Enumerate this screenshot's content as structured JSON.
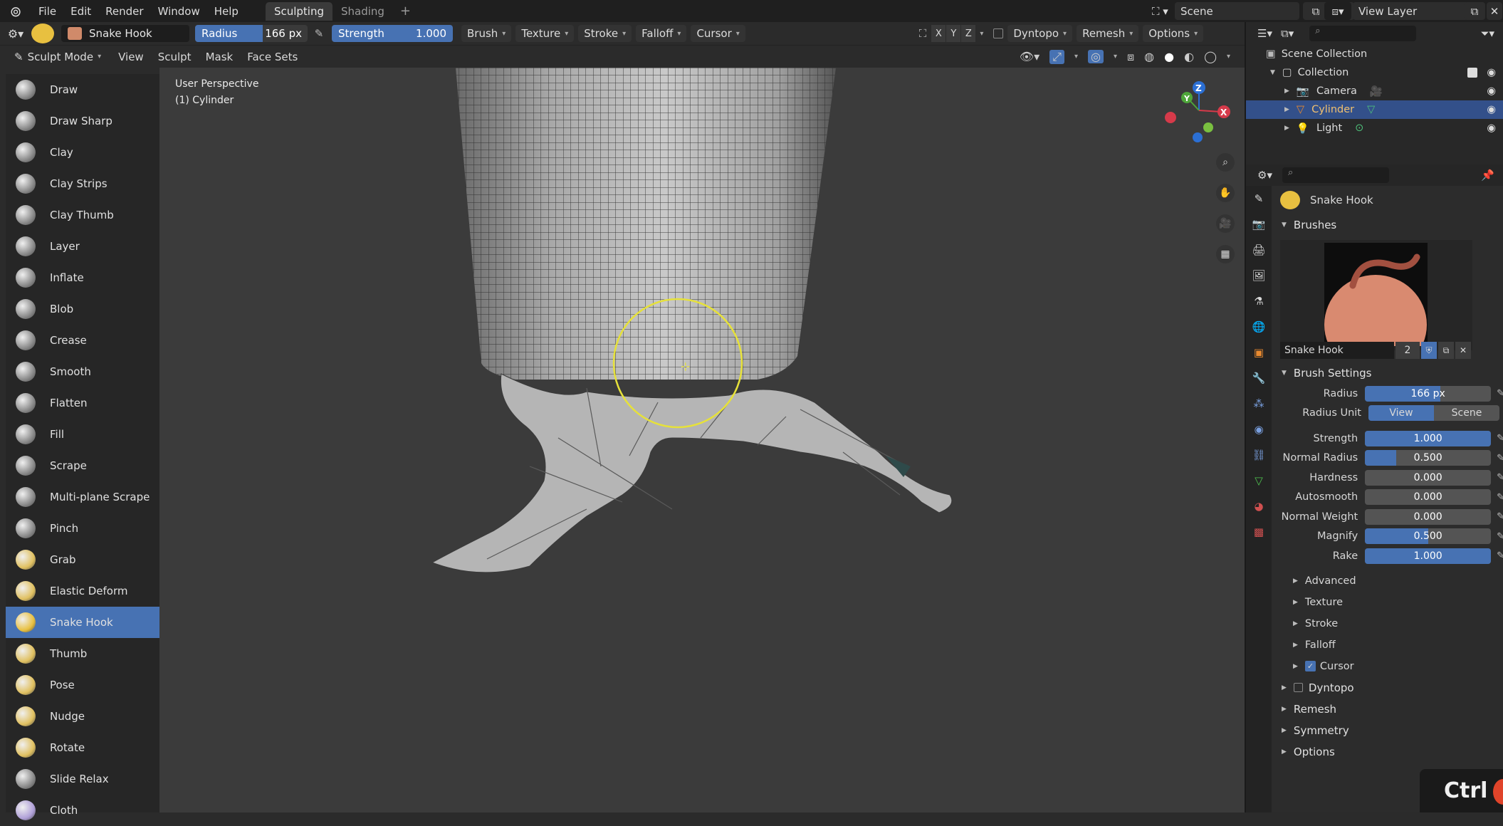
{
  "menu": [
    "File",
    "Edit",
    "Render",
    "Window",
    "Help"
  ],
  "workspaces": [
    {
      "label": "Sculpting",
      "active": true
    },
    {
      "label": "Shading",
      "active": false
    }
  ],
  "scene": "Scene",
  "view_layer": "View Layer",
  "header": {
    "brush_name": "Snake Hook",
    "radius_label": "Radius",
    "radius_value": "166 px",
    "strength_label": "Strength",
    "strength_value": "1.000",
    "menus": [
      "Brush",
      "Texture",
      "Stroke",
      "Falloff",
      "Cursor"
    ],
    "axes": [
      "X",
      "Y",
      "Z"
    ],
    "right_menus": [
      "Dyntopo",
      "Remesh",
      "Options"
    ]
  },
  "header2": {
    "mode": "Sculpt Mode",
    "items": [
      "View",
      "Sculpt",
      "Mask",
      "Face Sets"
    ]
  },
  "tools": [
    {
      "label": "Draw",
      "color": "#8a8a8a"
    },
    {
      "label": "Draw Sharp",
      "color": "#8a8a8a"
    },
    {
      "label": "Clay",
      "color": "#8a8a8a"
    },
    {
      "label": "Clay Strips",
      "color": "#8a8a8a"
    },
    {
      "label": "Clay Thumb",
      "color": "#8a8a8a"
    },
    {
      "label": "Layer",
      "color": "#8a8a8a"
    },
    {
      "label": "Inflate",
      "color": "#8a8a8a"
    },
    {
      "label": "Blob",
      "color": "#8a8a8a"
    },
    {
      "label": "Crease",
      "color": "#8a8a8a"
    },
    {
      "label": "Smooth",
      "color": "#8a8a8a"
    },
    {
      "label": "Flatten",
      "color": "#8a8a8a"
    },
    {
      "label": "Fill",
      "color": "#8a8a8a"
    },
    {
      "label": "Scrape",
      "color": "#8a8a8a"
    },
    {
      "label": "Multi-plane Scrape",
      "color": "#8a8a8a"
    },
    {
      "label": "Pinch",
      "color": "#8a8a8a"
    },
    {
      "label": "Grab",
      "color": "#e0c060"
    },
    {
      "label": "Elastic Deform",
      "color": "#e0c060"
    },
    {
      "label": "Snake Hook",
      "color": "#e8c040",
      "active": true
    },
    {
      "label": "Thumb",
      "color": "#e0c060"
    },
    {
      "label": "Pose",
      "color": "#e0c060"
    },
    {
      "label": "Nudge",
      "color": "#e0c060"
    },
    {
      "label": "Rotate",
      "color": "#e0c060"
    },
    {
      "label": "Slide Relax",
      "color": "#8a8a8a"
    },
    {
      "label": "Cloth",
      "color": "#b0a0d8"
    }
  ],
  "viewport": {
    "perspective": "User Perspective",
    "object": "(1) Cylinder"
  },
  "outliner": {
    "root": "Scene Collection",
    "collection": "Collection",
    "items": [
      {
        "label": "Camera",
        "selected": false
      },
      {
        "label": "Cylinder",
        "selected": true
      },
      {
        "label": "Light",
        "selected": false
      }
    ]
  },
  "props": {
    "brush_title": "Snake Hook",
    "brushes_section": "Brushes",
    "brush_name": "Snake Hook",
    "brush_users": "2",
    "settings_section": "Brush Settings",
    "rows": [
      {
        "label": "Radius",
        "value": "166 px",
        "fill": 0.6
      },
      {
        "label": "Strength",
        "value": "1.000",
        "fill": 1.0
      },
      {
        "label": "Normal Radius",
        "value": "0.500",
        "fill": 0.25
      },
      {
        "label": "Hardness",
        "value": "0.000",
        "fill": 0
      },
      {
        "label": "Autosmooth",
        "value": "0.000",
        "fill": 0
      },
      {
        "label": "Normal Weight",
        "value": "0.000",
        "fill": 0
      },
      {
        "label": "Magnify",
        "value": "0.500",
        "fill": 0.5
      },
      {
        "label": "Rake",
        "value": "1.000",
        "fill": 1.0
      }
    ],
    "radius_unit_label": "Radius Unit",
    "radius_unit_options": [
      "View",
      "Scene"
    ],
    "subsections": [
      "Advanced",
      "Texture",
      "Stroke",
      "Falloff",
      "Cursor"
    ],
    "sections": [
      "Dyntopo",
      "Remesh",
      "Symmetry",
      "Options"
    ]
  },
  "key_overlay": "Ctrl",
  "colors": {
    "accent": "#4772b3",
    "brush_circle": "#e6e13a"
  }
}
